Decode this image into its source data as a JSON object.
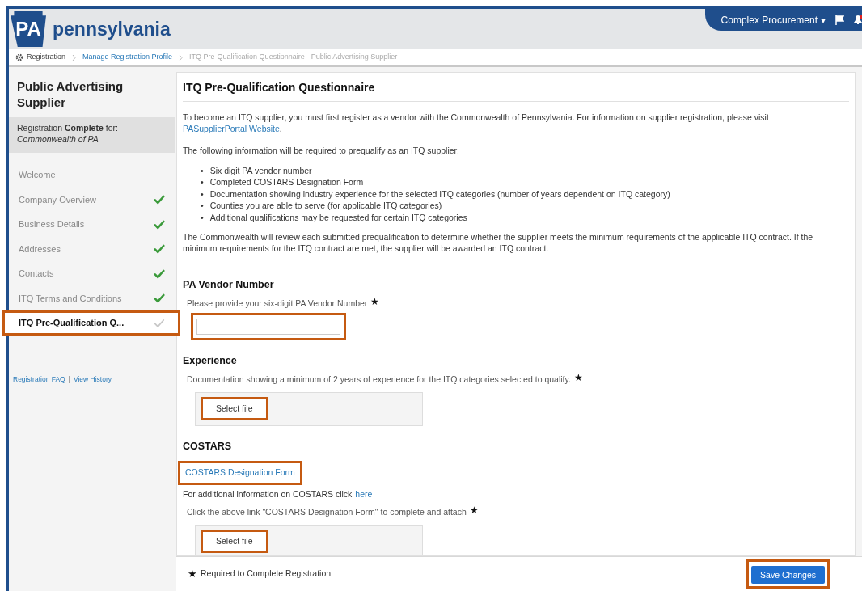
{
  "header": {
    "logo_mark": "PA",
    "logo_text": "pennsylvania",
    "user_menu": "Complex Procurement",
    "caret": "▾"
  },
  "breadcrumb": [
    {
      "label": "Registration",
      "kind": "home"
    },
    {
      "label": "Manage Registration Profile",
      "kind": "link"
    },
    {
      "label": "ITQ Pre-Qualification Questionnaire - Public Advertising Supplier",
      "kind": "current"
    }
  ],
  "sidebar": {
    "title": "Public Advertising Supplier",
    "status": "Registration **Complete** for:",
    "organization": "Commonwealth of PA",
    "items": [
      {
        "label": "Welcome",
        "kind": "plain",
        "selected": false,
        "highlighted": false
      },
      {
        "label": "Company Overview",
        "kind": "step",
        "checked": true,
        "selected": false,
        "highlighted": false
      },
      {
        "label": "Business Details",
        "kind": "step",
        "checked": true,
        "selected": false,
        "highlighted": false
      },
      {
        "label": "Addresses",
        "kind": "step",
        "checked": true,
        "selected": false,
        "highlighted": false
      },
      {
        "label": "Contacts",
        "kind": "step",
        "checked": true,
        "selected": false,
        "highlighted": false
      },
      {
        "label": "ITQ Terms and Conditions",
        "kind": "step",
        "checked": true,
        "selected": false,
        "highlighted": false
      },
      {
        "label": "ITQ Pre-Qualification Q...",
        "kind": "step",
        "checked": false,
        "selected": true,
        "highlighted": true
      }
    ],
    "links": [
      "Registration FAQ",
      "View History"
    ],
    "separator": "|"
  },
  "main": {
    "title": "ITQ Pre-Qualification Questionnaire",
    "intro": "To become an ITQ supplier, you must first register as a vendor with the Commonwealth of Pennsylvania. For information on supplier registration, please visit",
    "intro_link": "PASupplierPortal Website",
    "intro_end": ".",
    "requirements_lead": "The following information will be required to prequalify as an ITQ supplier:",
    "requirements": [
      {
        "bullet": "•",
        "text": "Six digit PA vendor number"
      },
      {
        "bullet": "•",
        "text": "Completed COSTARS Designation Form"
      },
      {
        "bullet": "•",
        "text": "Documentation showing industry experience for the selected ITQ categories (number of years dependent on ITQ category)"
      },
      {
        "bullet": "•",
        "text": "Counties you are able to serve (for applicable ITQ categories)"
      },
      {
        "bullet": "•",
        "text": "Additional qualifications may be requested for certain ITQ categories"
      }
    ],
    "review": "The Commonwealth will review each submitted prequalification to determine whether the supplier meets the minimum requirements of the applicable ITQ contract. If the minimum requirements for the ITQ contract are met, the supplier will be awarded an ITQ contract.",
    "sections": [
      {
        "heading": "PA Vendor Number",
        "blocks": [
          {
            "kind": "label",
            "text": "Please provide your six-digit PA Vendor Number",
            "required": "★"
          },
          {
            "kind": "input",
            "highlighted": true
          }
        ]
      },
      {
        "heading": "Experience",
        "blocks": [
          {
            "kind": "label",
            "text": "Documentation showing a minimum of 2 years of experience for the ITQ categories selected to qualify.",
            "required": "★"
          },
          {
            "kind": "file",
            "button": "Select file",
            "highlighted": true
          }
        ]
      },
      {
        "heading": "COSTARS",
        "blocks": [
          {
            "kind": "link",
            "text": "COSTARS Designation Form",
            "highlighted": true
          },
          {
            "kind": "info",
            "text": "For additional information on COSTARS click",
            "link": "here"
          },
          {
            "kind": "label",
            "text": "Click the above link \"COSTARS Designation Form\" to complete and attach",
            "required": "★"
          },
          {
            "kind": "file",
            "button": "Select file",
            "highlighted": true
          }
        ]
      }
    ]
  },
  "footer": {
    "star": "★",
    "note": "Required to Complete Registration",
    "save_button": "Save Changes",
    "highlighted": true
  }
}
